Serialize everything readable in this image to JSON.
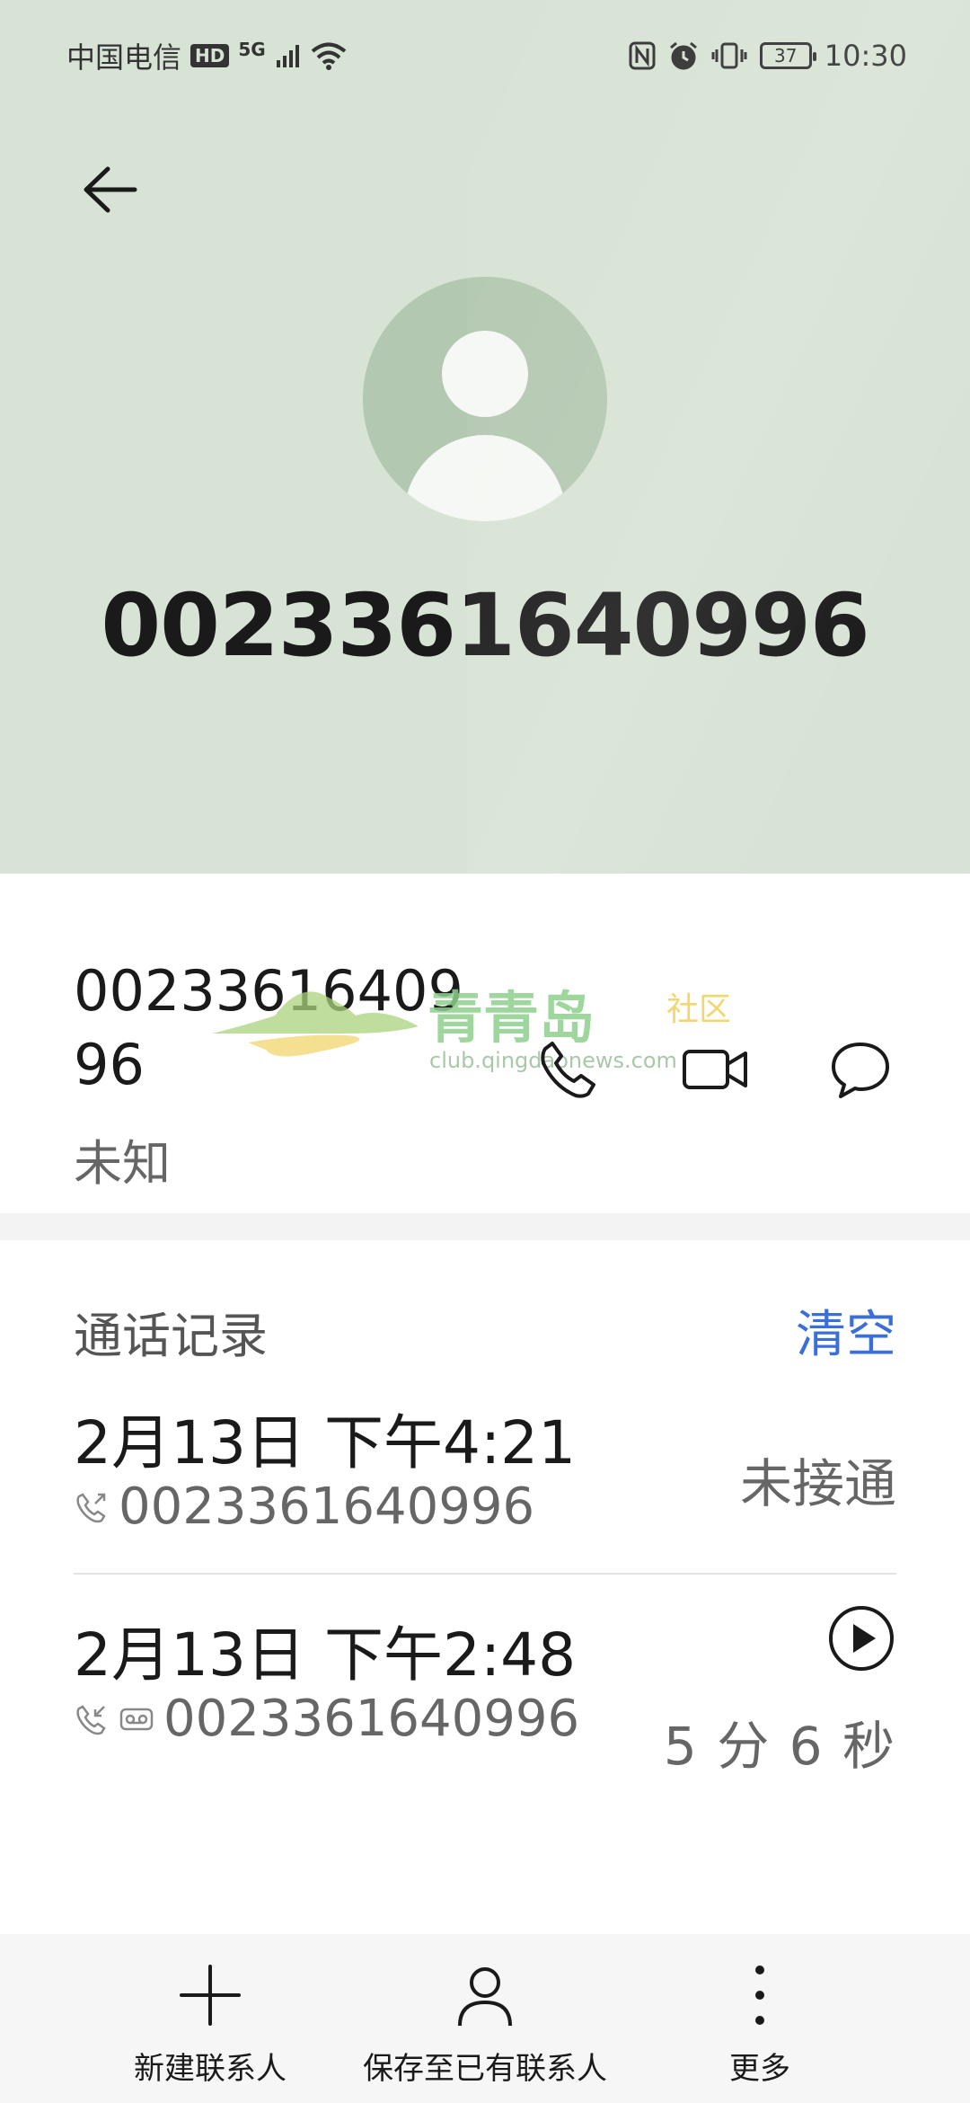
{
  "status_bar": {
    "carrier": "中国电信",
    "hd_badge": "HD",
    "network": "5G",
    "battery": "37",
    "time": "10:30"
  },
  "header": {
    "number": "0023361640996"
  },
  "contact": {
    "number": "0023361640996",
    "label": "未知"
  },
  "watermark": {
    "brand": "青青岛",
    "brand_suffix": "社区",
    "url": "club.qingdaonews.com"
  },
  "call_log": {
    "title": "通话记录",
    "clear_label": "清空",
    "entries": [
      {
        "time": "2月13日 下午4:21",
        "number": "0023361640996",
        "status": "未接通"
      },
      {
        "time": "2月13日 下午2:48",
        "number": "0023361640996",
        "duration": "5 分 6 秒"
      }
    ]
  },
  "bottom_bar": {
    "new_contact": "新建联系人",
    "save_existing": "保存至已有联系人",
    "more": "更多"
  },
  "colors": {
    "header_bg": "#d7e3d5",
    "avatar_bg": "#b3c8b1",
    "accent": "#3a6fd8"
  }
}
